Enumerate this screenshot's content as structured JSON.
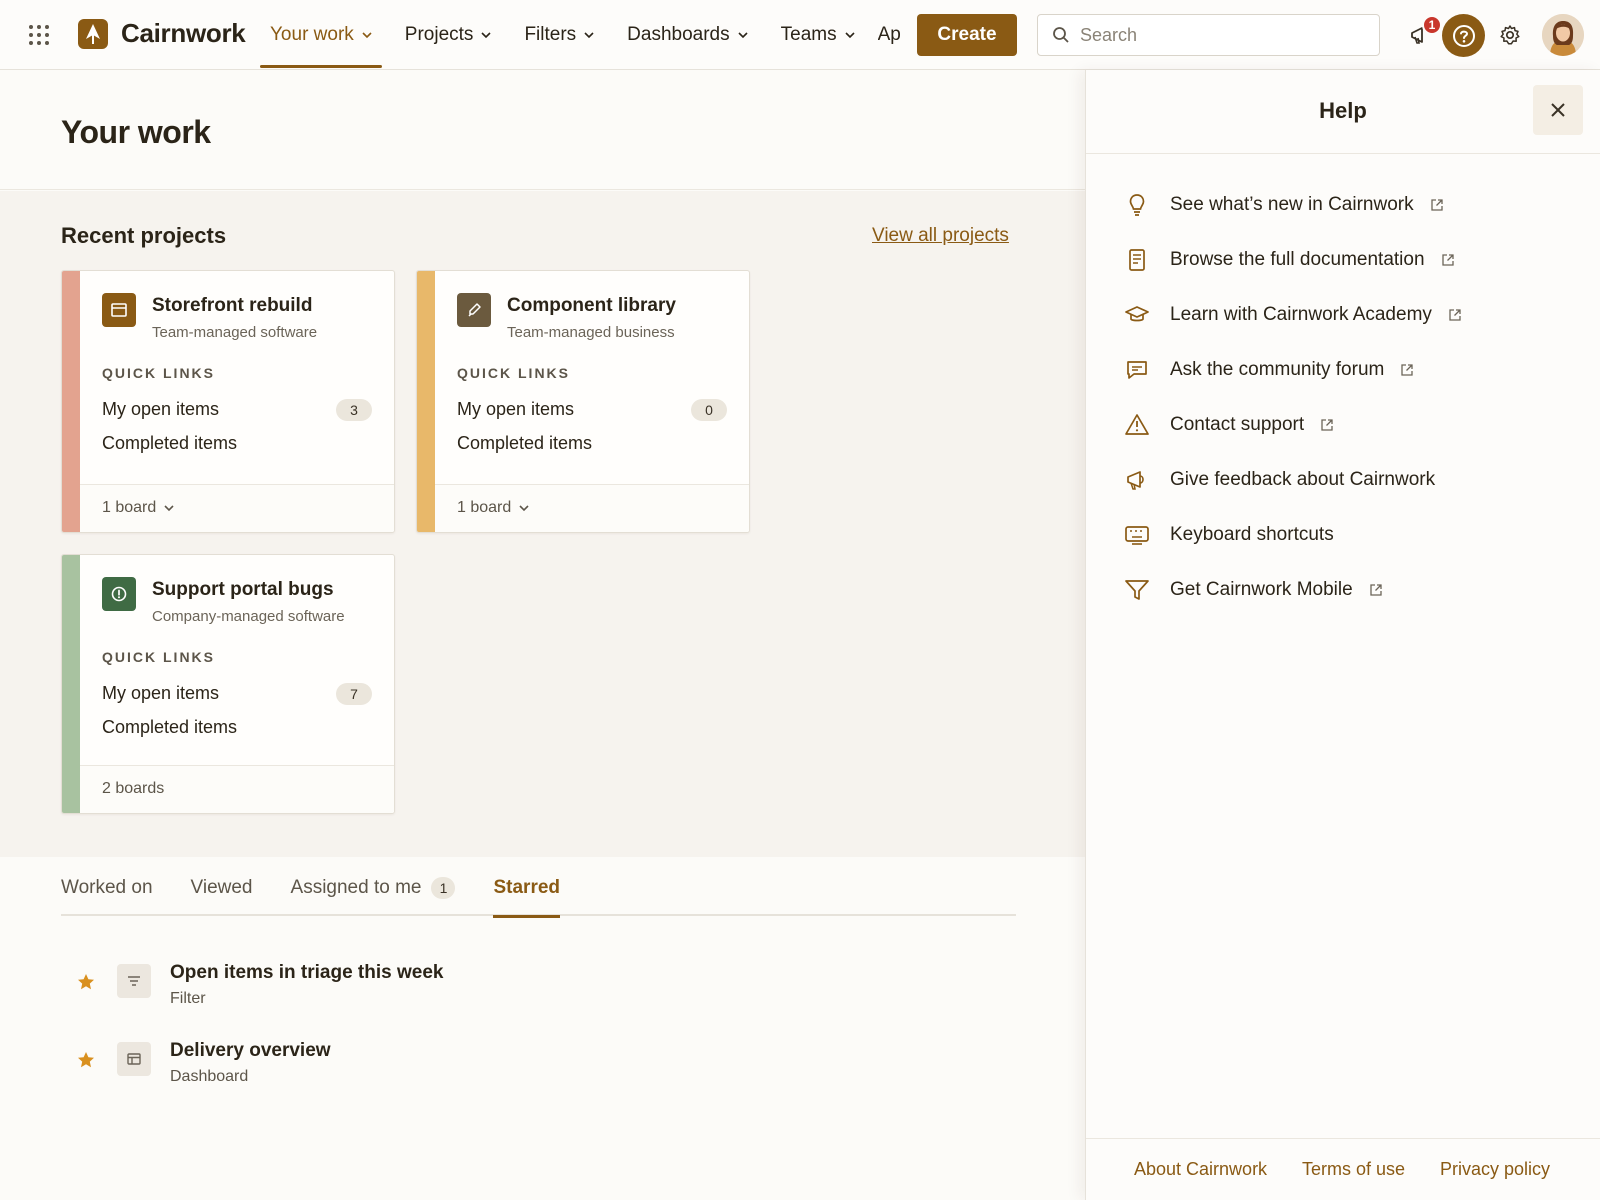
{
  "app": {
    "name": "Cairnwork"
  },
  "nav": {
    "items": [
      {
        "label": "Your work",
        "active": true
      },
      {
        "label": "Projects"
      },
      {
        "label": "Filters"
      },
      {
        "label": "Dashboards"
      },
      {
        "label": "Teams"
      },
      {
        "label": "Ap"
      }
    ],
    "create_label": "Create"
  },
  "search": {
    "placeholder": "Search",
    "value": ""
  },
  "notifications": {
    "count": "1"
  },
  "page": {
    "title": "Your work"
  },
  "recent": {
    "title": "Recent projects",
    "view_all": "View all projects",
    "quick_links_label": "QUICK LINKS",
    "projects": [
      {
        "name": "Storefront rebuild",
        "type": "Team-managed software",
        "open_label": "My open items",
        "open_count": "3",
        "done_label": "Completed items",
        "boards": "1 board",
        "stripe_color": "#e3a38f",
        "icon_color": "#8a5a14",
        "icon": "board-icon"
      },
      {
        "name": "Component library",
        "type": "Team-managed business",
        "open_label": "My open items",
        "open_count": "0",
        "done_label": "Completed items",
        "boards": "1 board",
        "stripe_color": "#e8b86a",
        "icon_color": "#6b5a3e",
        "icon": "brush-icon"
      },
      {
        "name": "Support portal bugs",
        "type": "Company-managed software",
        "open_label": "My open items",
        "open_count": "7",
        "done_label": "Completed items",
        "boards": "2 boards",
        "stripe_color": "#a8c2a0",
        "icon_color": "#3f6b44",
        "icon": "alert-circle-icon"
      }
    ]
  },
  "tabs": [
    {
      "label": "Worked on"
    },
    {
      "label": "Viewed"
    },
    {
      "label": "Assigned to me",
      "count": "1"
    },
    {
      "label": "Starred",
      "active": true
    }
  ],
  "starred": [
    {
      "name": "Open items in triage this week",
      "type": "Filter",
      "icon": "filter-lines-icon"
    },
    {
      "name": "Delivery overview",
      "type": "Dashboard",
      "icon": "dashboard-icon"
    }
  ],
  "help": {
    "title": "Help",
    "items": [
      {
        "label": "See what’s new in Cairnwork",
        "icon": "lightbulb-icon",
        "external": true
      },
      {
        "label": "Browse the full documentation",
        "icon": "book-icon",
        "external": true
      },
      {
        "label": "Learn with Cairnwork Academy",
        "icon": "graduation-cap-icon",
        "external": true
      },
      {
        "label": "Ask the community forum",
        "icon": "comment-icon",
        "external": true
      },
      {
        "label": "Contact support",
        "icon": "warning-icon",
        "external": true
      },
      {
        "label": "Give feedback about Cairnwork",
        "icon": "megaphone-icon",
        "external": false
      },
      {
        "label": "Keyboard shortcuts",
        "icon": "keyboard-icon",
        "external": false
      },
      {
        "label": "Get Cairnwork Mobile",
        "icon": "funnel-icon",
        "external": true
      }
    ],
    "footer": [
      "About Cairnwork",
      "Terms of use",
      "Privacy policy"
    ]
  },
  "colors": {
    "accent": "#8a5a14",
    "badge": "#c9372c",
    "star": "#d9901f"
  }
}
